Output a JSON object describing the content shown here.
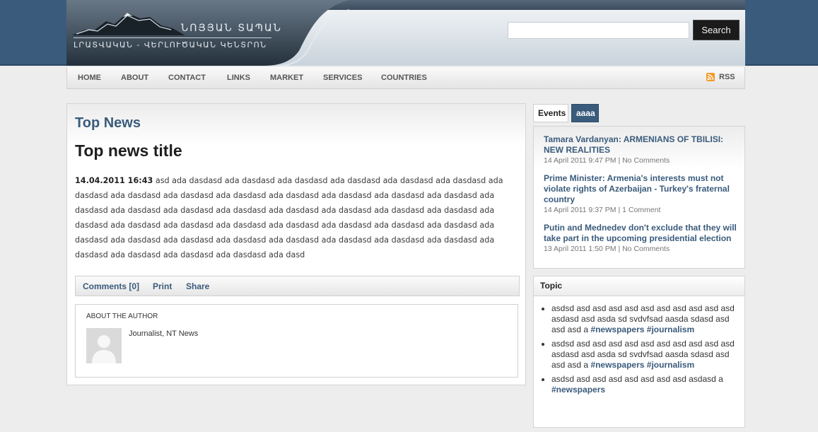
{
  "header": {
    "logo_title": "ՆՈՅՅԱՆ ՏԱՊԱՆ",
    "logo_subtitle": "ԼՐԱՏՎԱԿԱՆ - ՎԵՐԼՈՒԾԱԿԱՆ ԿԵՆՏՐՈՆ",
    "search_placeholder": "",
    "search_button": "Search"
  },
  "nav": {
    "items": [
      "HOME",
      "ABOUT",
      "CONTACT",
      "LINKS",
      "MARKET",
      "SERVICES",
      "COUNTRIES"
    ],
    "rss": "RSS"
  },
  "main": {
    "section_title": "Top News",
    "news_title": "Top news title",
    "date": "14.04.2011 16:43",
    "body": "asd ada dasdasd ada dasdasd ada dasdasd ada dasdasd ada dasdasd ada dasdasd ada dasdasd ada dasdasd ada dasdasd ada dasdasd ada dasdasd ada dasdasd ada dasdasd ada dasdasd ada dasdasd ada dasdasd ada dasdasd ada dasdasd ada dasdasd ada dasdasd ada dasdasd ada dasdasd ada dasdasd ada dasdasd ada dasdasd ada dasdasd ada dasdasd ada dasdasd ada dasdasd ada dasdasd ada dasdasd ada dasdasd ada dasdasd ada dasdasd ada dasdasd ada dasdasd ada dasdasd ada dasdasd ada dasdasd ada dasdasd ada dasdasd ada dasdasd ada dasd",
    "toolbar": {
      "comments": "Comments [0]",
      "print": "Print",
      "share": "Share"
    },
    "author": {
      "heading": "ABOUT THE AUTHOR",
      "description": "Journalist, NT News"
    }
  },
  "sidebar": {
    "tabs": [
      "Events",
      "aaaa"
    ],
    "events": [
      {
        "title": "Tamara Vardanyan: ARMENIANS OF TBILISI: NEW REALITIES",
        "meta": "14 April 2011 9:47 PM | No Comments"
      },
      {
        "title": "Prime Minister: Armenia's interests must not violate rights of Azerbaijan - Turkey's fraternal country",
        "meta": "14 April 2011 9:37 PM | 1 Comment"
      },
      {
        "title": "Putin and Mednedev don't exclude that they will take part in the upcoming presidential election",
        "meta": "13 April 2011 1:50 PM | No Comments"
      }
    ],
    "topic": {
      "title": "Topic",
      "items": [
        {
          "text": "asdsd asd asd asd asd asd asd asd asd asd asd asdasd asd asda sd svdvfsad aasda sdasd asd asd asd a",
          "tags": [
            "#newspapers",
            "#journalism"
          ]
        },
        {
          "text": "asdsd asd asd asd asd asd asd asd asd asd asd asdasd asd asda sd svdvfsad aasda sdasd asd asd asd a",
          "tags": [
            "#newspapers",
            "#journalism"
          ]
        },
        {
          "text": "asdsd asd asd asd asd asd asd asd asdasd a",
          "tags": [
            "#newspapers"
          ]
        }
      ]
    }
  },
  "colors": {
    "brand": "#3a5b7c",
    "search_button_bg": "#1b1b1b",
    "rss": "#f39a2a"
  },
  "icons": {
    "rss": "rss-icon",
    "avatar": "user-placeholder-icon"
  }
}
